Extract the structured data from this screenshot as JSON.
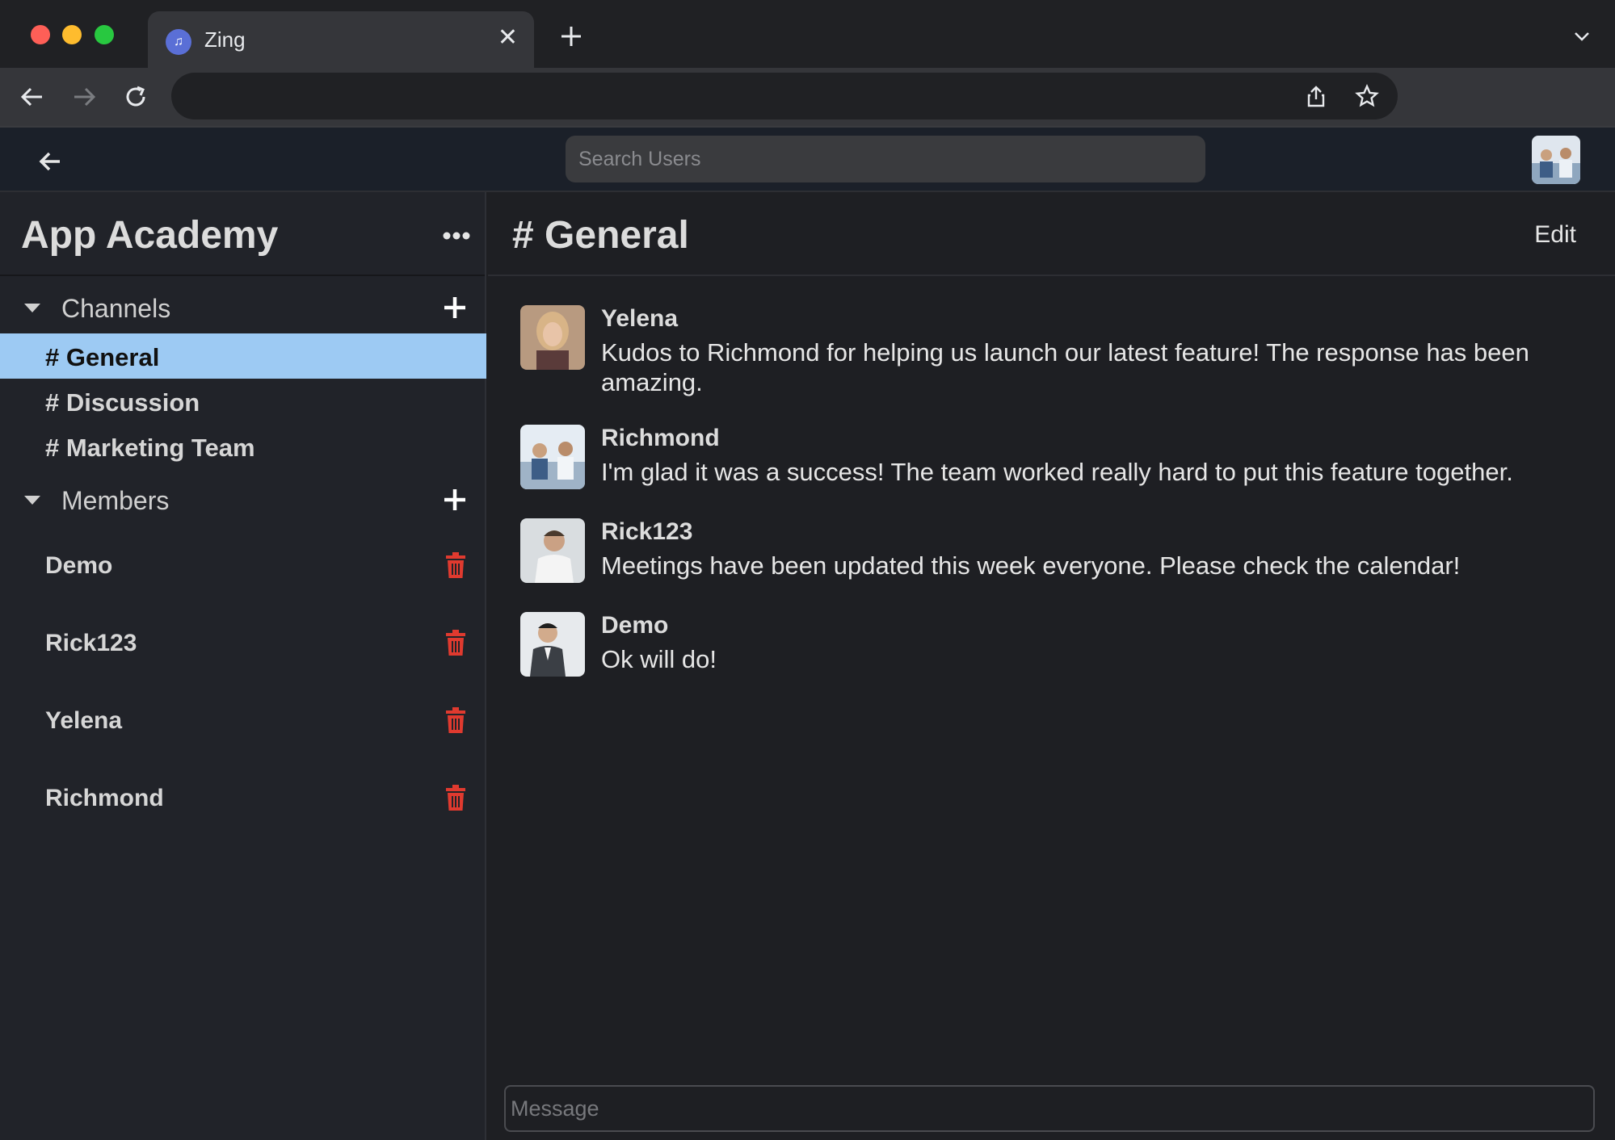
{
  "browser": {
    "tab_title": "Zing",
    "address": ""
  },
  "app": {
    "search_placeholder": "Search Users"
  },
  "sidebar": {
    "workspace_name": "App Academy",
    "channels_label": "Channels",
    "channels": [
      {
        "label": "# General",
        "active": true
      },
      {
        "label": "# Discussion",
        "active": false
      },
      {
        "label": "# Marketing Team",
        "active": false
      }
    ],
    "members_label": "Members",
    "members": [
      {
        "name": "Demo"
      },
      {
        "name": "Rick123"
      },
      {
        "name": "Yelena"
      },
      {
        "name": "Richmond"
      }
    ]
  },
  "main": {
    "channel_title": "# General",
    "edit_label": "Edit",
    "messages": [
      {
        "author": "Yelena",
        "text": "Kudos to Richmond for helping us launch our latest feature! The response has been amazing."
      },
      {
        "author": "Richmond",
        "text": "I'm glad it was a success! The team worked really hard to put this feature together."
      },
      {
        "author": "Rick123",
        "text": "Meetings have been updated this week everyone. Please check the calendar!"
      },
      {
        "author": "Demo",
        "text": "Ok will do!"
      }
    ],
    "composer_placeholder": "Message"
  },
  "colors": {
    "active_channel": "#9dcaf3",
    "trash": "#e03a2f"
  }
}
